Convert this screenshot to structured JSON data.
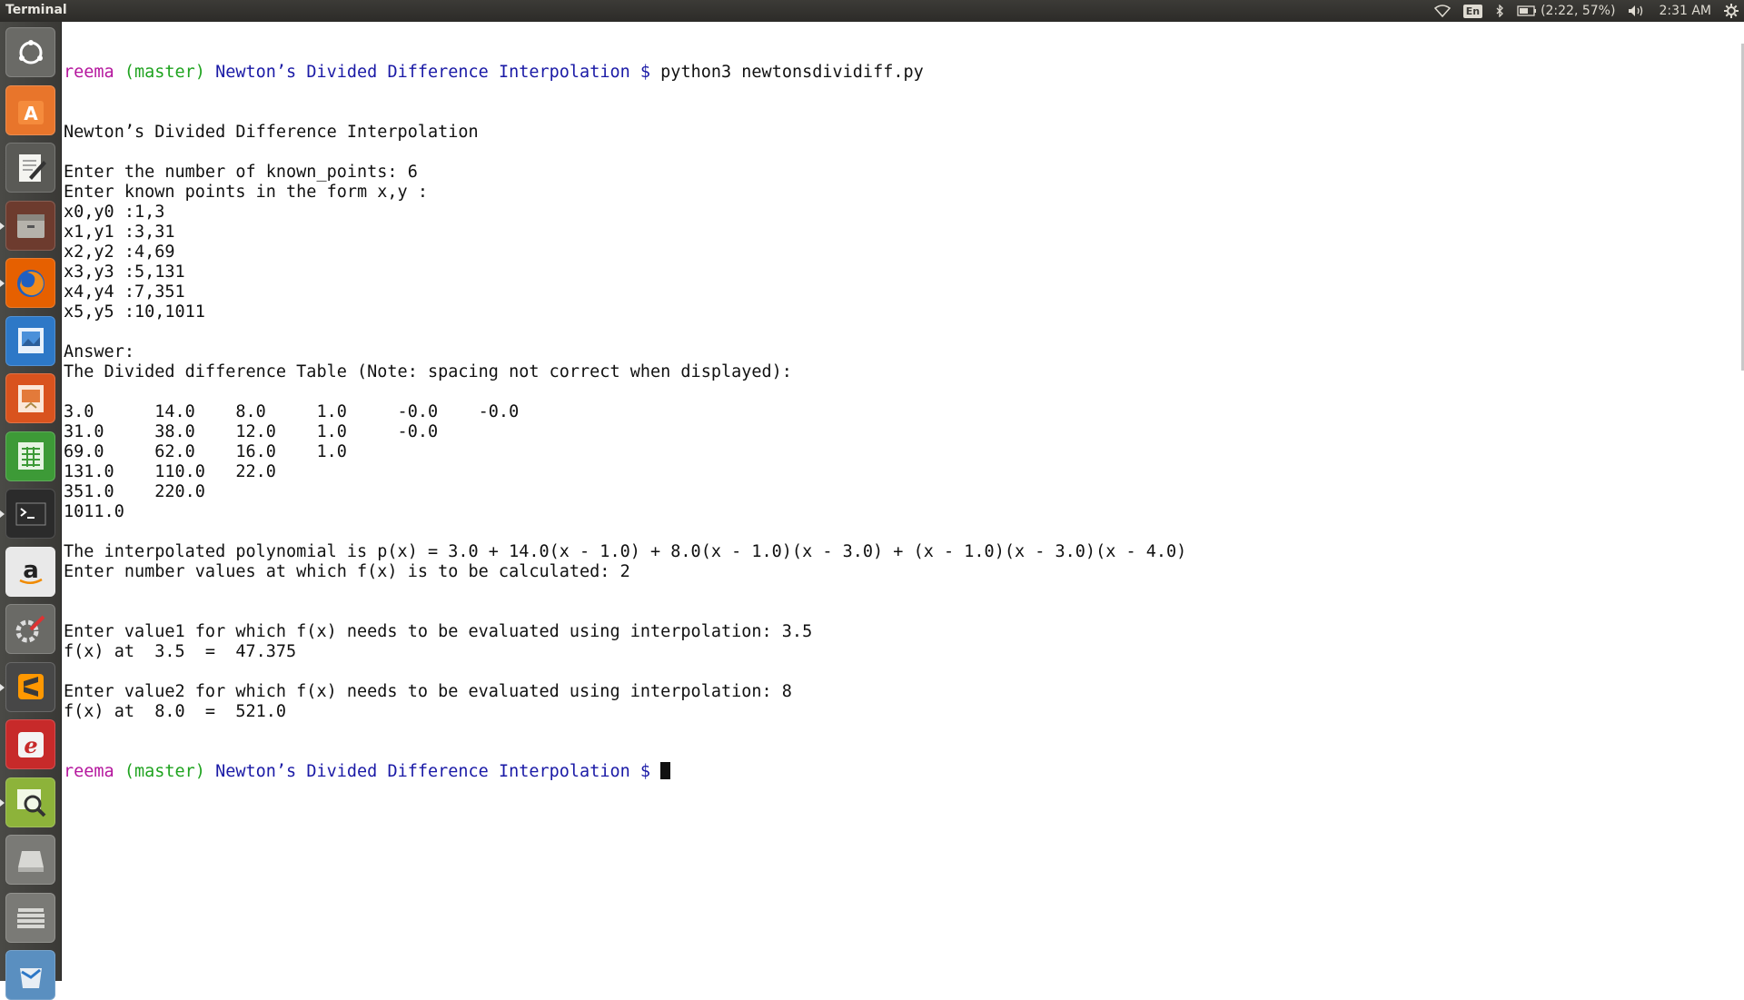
{
  "window": {
    "title": "Terminal"
  },
  "indicators": {
    "keyboard": "En",
    "battery": "(2:22, 57%)",
    "time": "2:31 AM"
  },
  "launcher": [
    {
      "name": "dash-home-icon",
      "bg": "#6a6a66"
    },
    {
      "name": "software-center-icon",
      "bg": "#e8752b"
    },
    {
      "name": "text-editor-icon",
      "bg": "#5a5a56"
    },
    {
      "name": "files-icon",
      "bg": "#6d3b2e"
    },
    {
      "name": "firefox-icon",
      "bg": "#e66000"
    },
    {
      "name": "image-viewer-icon",
      "bg": "#2d78c7"
    },
    {
      "name": "impress-icon",
      "bg": "#d9531e"
    },
    {
      "name": "calc-icon",
      "bg": "#3d9a37"
    },
    {
      "name": "terminal-icon",
      "bg": "#2b2b2b"
    },
    {
      "name": "amazon-icon",
      "bg": "#e9e9e9"
    },
    {
      "name": "system-settings-icon",
      "bg": "#6a6a66"
    },
    {
      "name": "sublime-text-icon",
      "bg": "#474747"
    },
    {
      "name": "app-e-icon",
      "bg": "#c72a2a"
    },
    {
      "name": "system-monitor-icon",
      "bg": "#8db33a"
    },
    {
      "name": "drive-icon",
      "bg": "#7a7a76"
    },
    {
      "name": "drive-stack-icon",
      "bg": "#7a7a76"
    },
    {
      "name": "trash-icon",
      "bg": "#5a8fc0"
    }
  ],
  "terminal": {
    "prompt": {
      "user": "reema",
      "branch": "(master)",
      "dir": "Newton’s Divided Difference Interpolation",
      "symbol": "$"
    },
    "command": "python3 newtonsdividiff.py",
    "lines": [
      "Newton’s Divided Difference Interpolation",
      "",
      "Enter the number of known_points: 6",
      "Enter known points in the form x,y :",
      "x0,y0 :1,3",
      "x1,y1 :3,31",
      "x2,y2 :4,69",
      "x3,y3 :5,131",
      "x4,y4 :7,351",
      "x5,y5 :10,1011",
      "",
      "Answer:",
      "The Divided difference Table (Note: spacing not correct when displayed):",
      "",
      "3.0      14.0    8.0     1.0     -0.0    -0.0",
      "31.0     38.0    12.0    1.0     -0.0",
      "69.0     62.0    16.0    1.0",
      "131.0    110.0   22.0",
      "351.0    220.0",
      "1011.0",
      "",
      "The interpolated polynomial is p(x) = 3.0 + 14.0(x - 1.0) + 8.0(x - 1.0)(x - 3.0) + (x - 1.0)(x - 3.0)(x - 4.0)",
      "Enter number values at which f(x) is to be calculated: 2",
      "",
      "",
      "Enter value1 for which f(x) needs to be evaluated using interpolation: 3.5",
      "f(x) at  3.5  =  47.375",
      "",
      "Enter value2 for which f(x) needs to be evaluated using interpolation: 8",
      "f(x) at  8.0  =  521.0"
    ]
  }
}
